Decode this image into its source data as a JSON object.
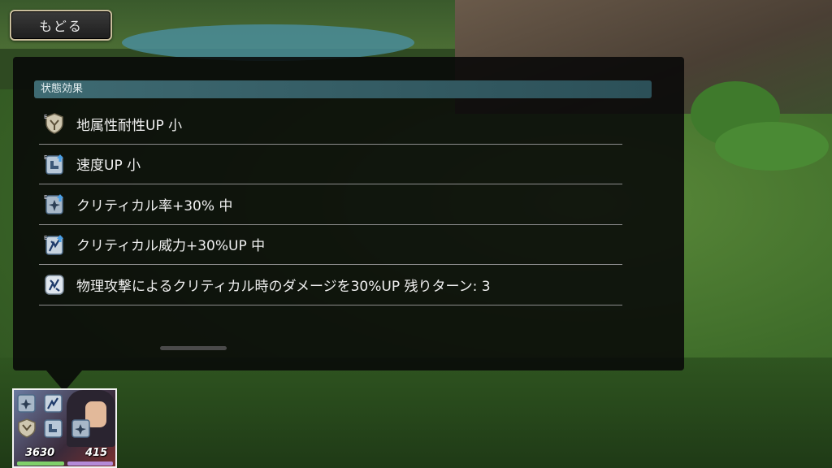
{
  "back_button": {
    "label": "もどる"
  },
  "panel": {
    "section_title": "状態効果",
    "effects": [
      {
        "label": "地属性耐性UP 小",
        "icon": "earth-resist-up-icon"
      },
      {
        "label": "速度UP 小",
        "icon": "speed-up-icon"
      },
      {
        "label": "クリティカル率+30% 中",
        "icon": "critical-rate-up-icon"
      },
      {
        "label": "クリティカル威力+30%UP 中",
        "icon": "critical-damage-up-icon"
      },
      {
        "label": "物理攻撃によるクリティカル時のダメージを30%UP 残りターン: 3",
        "icon": "physical-critical-damage-icon"
      }
    ]
  },
  "character": {
    "hp": "3630",
    "bp": "415",
    "status_icons": [
      "critical-rate-up-icon",
      "critical-damage-up-icon",
      "earth-resist-up-icon",
      "speed-up-icon",
      "critical-rate-up-icon"
    ]
  },
  "colors": {
    "header_accent": "#3e6a72",
    "hp_bar": "#7fd06a",
    "bp_bar": "#b48ad8"
  }
}
